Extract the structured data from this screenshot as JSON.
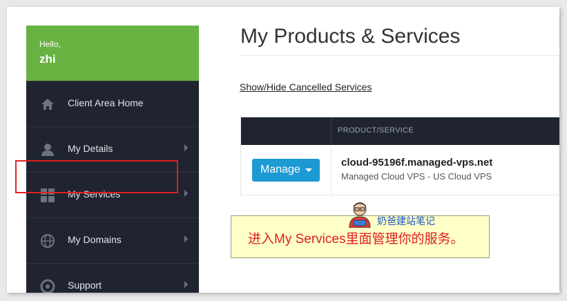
{
  "sidebar": {
    "greeting": "Hello,",
    "username": "zhi",
    "items": [
      {
        "label": "Client Area Home",
        "icon": "home-icon"
      },
      {
        "label": "My Details",
        "icon": "user-icon"
      },
      {
        "label": "My Services",
        "icon": "grid-icon"
      },
      {
        "label": "My Domains",
        "icon": "globe-icon"
      },
      {
        "label": "Support",
        "icon": "lifebuoy-icon"
      }
    ]
  },
  "main": {
    "title": "My Products & Services",
    "toggle_link": "Show/Hide Cancelled Services",
    "table": {
      "header": "PRODUCT/SERVICE",
      "rows": [
        {
          "action_label": "Manage",
          "name": "cloud-95196f.managed-vps.net",
          "description": "Managed Cloud VPS - US Cloud VPS"
        }
      ]
    }
  },
  "annotation": {
    "text": "进入My Services里面管理你的服务。",
    "watermark": "奶爸建站笔记"
  },
  "colors": {
    "sidebar_bg": "#1f2430",
    "greeting_bg": "#68b242",
    "button_blue": "#1d99d4",
    "highlight_red": "#e02020",
    "note_bg": "#ffffc8"
  }
}
